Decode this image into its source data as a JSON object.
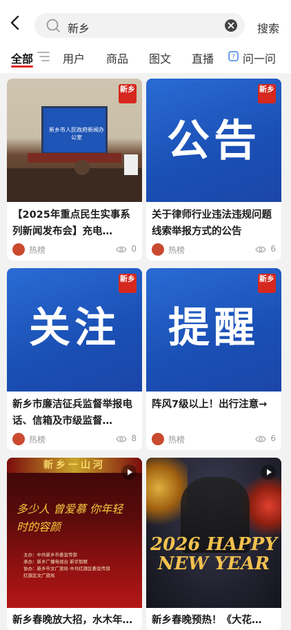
{
  "search": {
    "query": "新乡",
    "button_label": "搜索"
  },
  "tabs": [
    {
      "label": "全部",
      "active": true
    },
    {
      "label": "用户"
    },
    {
      "label": "商品"
    },
    {
      "label": "图文"
    },
    {
      "label": "直播"
    },
    {
      "label": "问一问"
    }
  ],
  "cards": [
    {
      "title": "【2025年重点民生实事系列新闻发布会】充电…",
      "author": "热榜",
      "views": "0",
      "badge": "新乡",
      "thumb_type": "photo",
      "thumb_text": "新乡市人民政府新闻办公室"
    },
    {
      "title": "关于律师行业违法违规问题线索举报方式的公告",
      "author": "热榜",
      "views": "6",
      "badge": "新乡",
      "thumb_type": "word",
      "thumb_text": "公告"
    },
    {
      "title": "新乡市廉洁征兵监督举报电话、信箱及市级监督…",
      "author": "热榜",
      "views": "8",
      "badge": "新乡",
      "thumb_type": "word",
      "thumb_text": "关注"
    },
    {
      "title": "阵风7级以上！出行注意→",
      "author": "热榜",
      "views": "6",
      "badge": "新乡",
      "thumb_type": "word",
      "thumb_text": "提醒"
    },
    {
      "title": "新乡春晚放大招，水木年…",
      "author": "",
      "views": "",
      "thumb_type": "video",
      "thumb_text": "多少人 曾爱慕 你年轻时的容颜",
      "thumb_top_text": "新乡一山河",
      "thumb_credits": [
        "主办：中共新乡市委宣传部",
        "承办：新乡广播电视台 新华智联",
        "协办：新乡市文广旅局 中共红旗区委宣传部",
        "红旗区文广旅局"
      ]
    },
    {
      "title": "新乡春晚预热！《大花…",
      "author": "",
      "views": "",
      "thumb_type": "video",
      "thumb_text": "2026 HAPPY NEW YEAR"
    }
  ],
  "colors": {
    "accent": "#e02020",
    "badge": "#d6281e",
    "poster_blue": "#1f55c0"
  }
}
